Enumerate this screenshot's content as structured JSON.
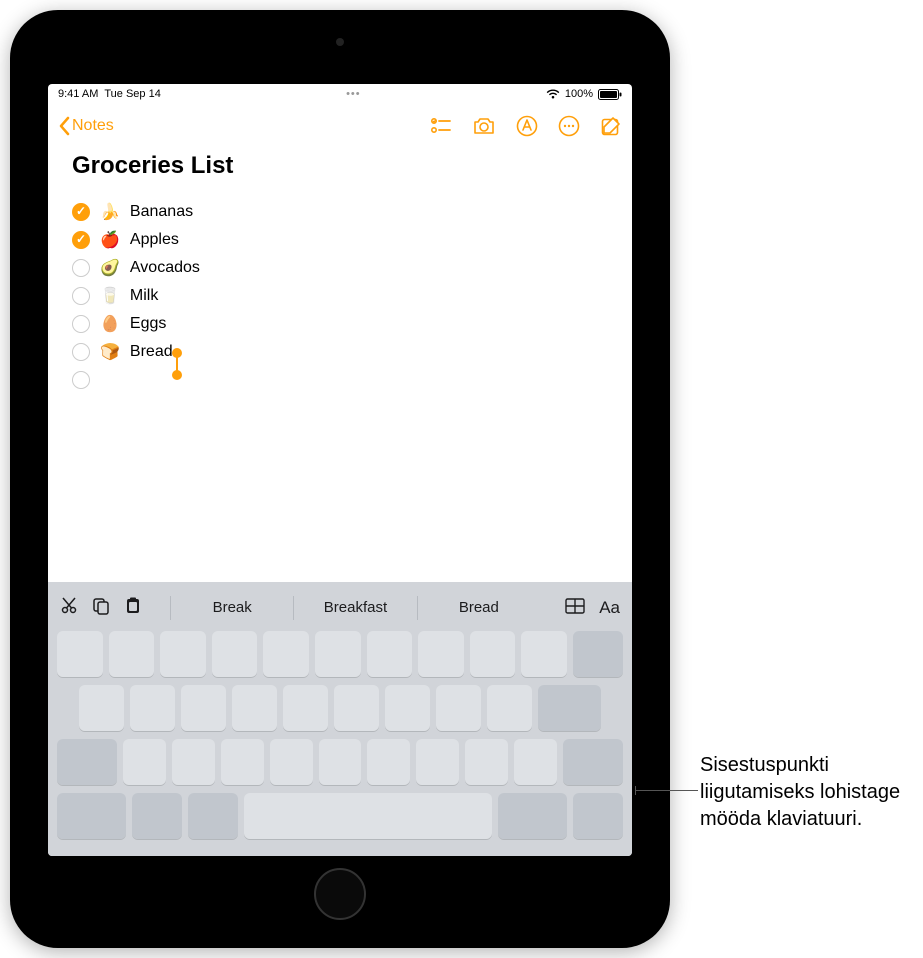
{
  "status": {
    "time": "9:41 AM",
    "date": "Tue Sep 14",
    "battery_pct": "100%"
  },
  "navbar": {
    "back_label": "Notes"
  },
  "note": {
    "title": "Groceries List",
    "items": [
      {
        "checked": true,
        "emoji": "🍌",
        "text": "Bananas"
      },
      {
        "checked": true,
        "emoji": "🍎",
        "text": "Apples"
      },
      {
        "checked": false,
        "emoji": "🥑",
        "text": "Avocados"
      },
      {
        "checked": false,
        "emoji": "🥛",
        "text": "Milk"
      },
      {
        "checked": false,
        "emoji": "🥚",
        "text": "Eggs"
      },
      {
        "checked": false,
        "emoji": "🍞",
        "text": "Bread",
        "cursor": true
      },
      {
        "checked": false,
        "emoji": "",
        "text": ""
      }
    ]
  },
  "keyboard": {
    "suggestions": [
      "Break",
      "Breakfast",
      "Bread"
    ]
  },
  "callout": {
    "text": "Sisestuspunkti liigutamiseks lohistage mööda klaviatuuri."
  },
  "colors": {
    "accent": "#ff9f0a"
  }
}
